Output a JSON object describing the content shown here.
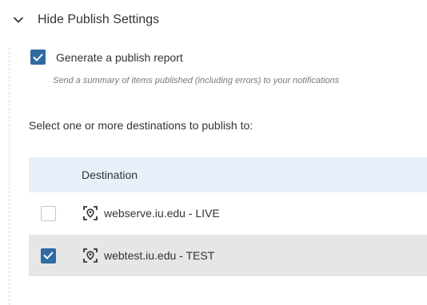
{
  "publish_settings": {
    "toggle_label": "Hide Publish Settings",
    "toggle_icon": "chevron-down-icon",
    "report": {
      "checked": true,
      "label": "Generate a publish report",
      "hint": "Send a summary of items published (including errors) to your notifications"
    },
    "destinations_prompt": "Select one or more destinations to publish to:",
    "table": {
      "column_header": "Destination",
      "rows": [
        {
          "name": "webserve.iu.edu - LIVE",
          "checked": false,
          "icon": "destination-icon"
        },
        {
          "name": "webtest.iu.edu - TEST",
          "checked": true,
          "icon": "destination-icon"
        }
      ]
    }
  },
  "colors": {
    "accent": "#2f6ba3",
    "header_bg": "#e8f1f9",
    "selected_row_bg": "#e6e6e6"
  }
}
